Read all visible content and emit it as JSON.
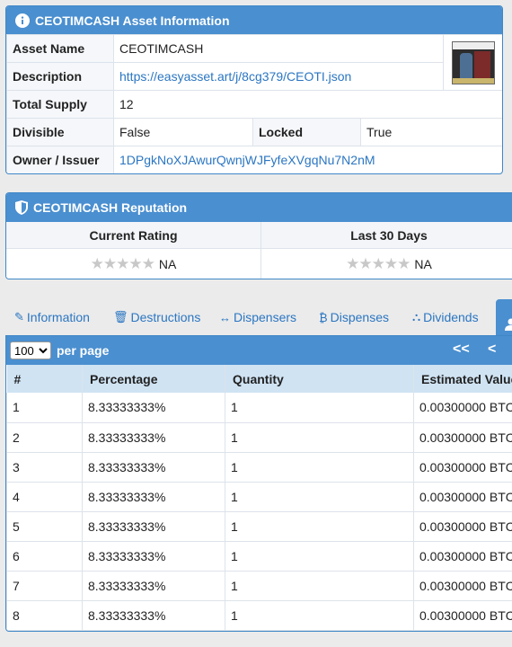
{
  "asset_info": {
    "title": "CEOTIMCASH Asset Information",
    "rows": {
      "asset_name_label": "Asset Name",
      "asset_name": "CEOTIMCASH",
      "description_label": "Description",
      "description": "https://easyasset.art/j/8cg379/CEOTI.json",
      "total_supply_label": "Total Supply",
      "total_supply": "12",
      "divisible_label": "Divisible",
      "divisible": "False",
      "locked_label": "Locked",
      "locked": "True",
      "owner_label": "Owner / Issuer",
      "owner": "1DPgkNoXJAwurQwnjWJFyfeXVgqNu7N2nM"
    }
  },
  "reputation": {
    "title": "CEOTIMCASH Reputation",
    "current_rating_label": "Current Rating",
    "last30_label": "Last 30 Days",
    "current_rating": "NA",
    "last30": "NA",
    "stars": "★★★★★"
  },
  "tabs": [
    {
      "icon": "✎",
      "label": "Information"
    },
    {
      "icon": "🗑",
      "label": "Destructions"
    },
    {
      "icon": "↔",
      "label": "Dispensers"
    },
    {
      "icon": "₿",
      "label": "Dispenses"
    },
    {
      "icon": "⛬",
      "label": "Dividends"
    }
  ],
  "holders": {
    "page_size": "100",
    "per_page_label": "per page",
    "first_btn": "<<",
    "prev_btn": "<",
    "headers": [
      "#",
      "Percentage",
      "Quantity",
      "Estimated Value"
    ],
    "rows": [
      [
        "1",
        "8.33333333%",
        "1",
        "0.00300000 BTC"
      ],
      [
        "2",
        "8.33333333%",
        "1",
        "0.00300000 BTC"
      ],
      [
        "3",
        "8.33333333%",
        "1",
        "0.00300000 BTC"
      ],
      [
        "4",
        "8.33333333%",
        "1",
        "0.00300000 BTC"
      ],
      [
        "5",
        "8.33333333%",
        "1",
        "0.00300000 BTC"
      ],
      [
        "6",
        "8.33333333%",
        "1",
        "0.00300000 BTC"
      ],
      [
        "7",
        "8.33333333%",
        "1",
        "0.00300000 BTC"
      ],
      [
        "8",
        "8.33333333%",
        "1",
        "0.00300000 BTC"
      ]
    ]
  },
  "colors": {
    "header_blue": "#4a8fd0",
    "link_blue": "#2b76c2",
    "table_header_bg": "#cfe3f3"
  }
}
